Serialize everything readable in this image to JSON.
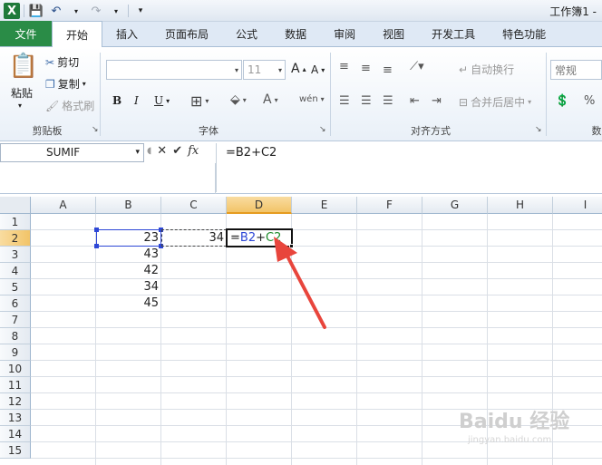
{
  "titlebar": {
    "title": "工作簿1 -",
    "app_logo": "X"
  },
  "tabs": [
    "文件",
    "开始",
    "插入",
    "页面布局",
    "公式",
    "数据",
    "审阅",
    "视图",
    "开发工具",
    "特色功能"
  ],
  "ribbon": {
    "clipboard": {
      "paste": "粘贴",
      "cut": "剪切",
      "copy": "复制",
      "format_painter": "格式刷",
      "label": "剪贴板"
    },
    "font": {
      "font_size": "11",
      "label": "字体",
      "bold": "B",
      "italic": "I",
      "underline": "U",
      "grow": "A",
      "shrink": "A",
      "font_color": "A",
      "phonetic": "wén"
    },
    "alignment": {
      "wrap_text": "自动换行",
      "merge_center": "合并后居中",
      "label": "对齐方式"
    },
    "number": {
      "format": "常规",
      "percent": "%",
      "label_partial": "数"
    }
  },
  "formula_bar": {
    "name_box": "SUMIF",
    "fx": "fx",
    "formula": "=B2+C2"
  },
  "sheet": {
    "columns": [
      "A",
      "B",
      "C",
      "D",
      "E",
      "F",
      "G",
      "H",
      "I"
    ],
    "rows": [
      "1",
      "2",
      "3",
      "4",
      "5",
      "6",
      "7",
      "8",
      "9",
      "10",
      "11",
      "12",
      "13",
      "14",
      "15"
    ],
    "b_values": [
      "23",
      "43",
      "42",
      "34",
      "45"
    ],
    "c2": "34",
    "d2_editing": {
      "eq": "=",
      "b2": "B2",
      "plus": "+",
      "c2": "C2"
    }
  },
  "colors": {
    "file_tab": "#2a8c47",
    "ref_b": "#2d47d6",
    "ref_c": "#1d8a2a",
    "arrow": "#e8453c"
  },
  "watermark": {
    "main": "Baidu 经验",
    "sub": "jingyan.baidu.com"
  }
}
